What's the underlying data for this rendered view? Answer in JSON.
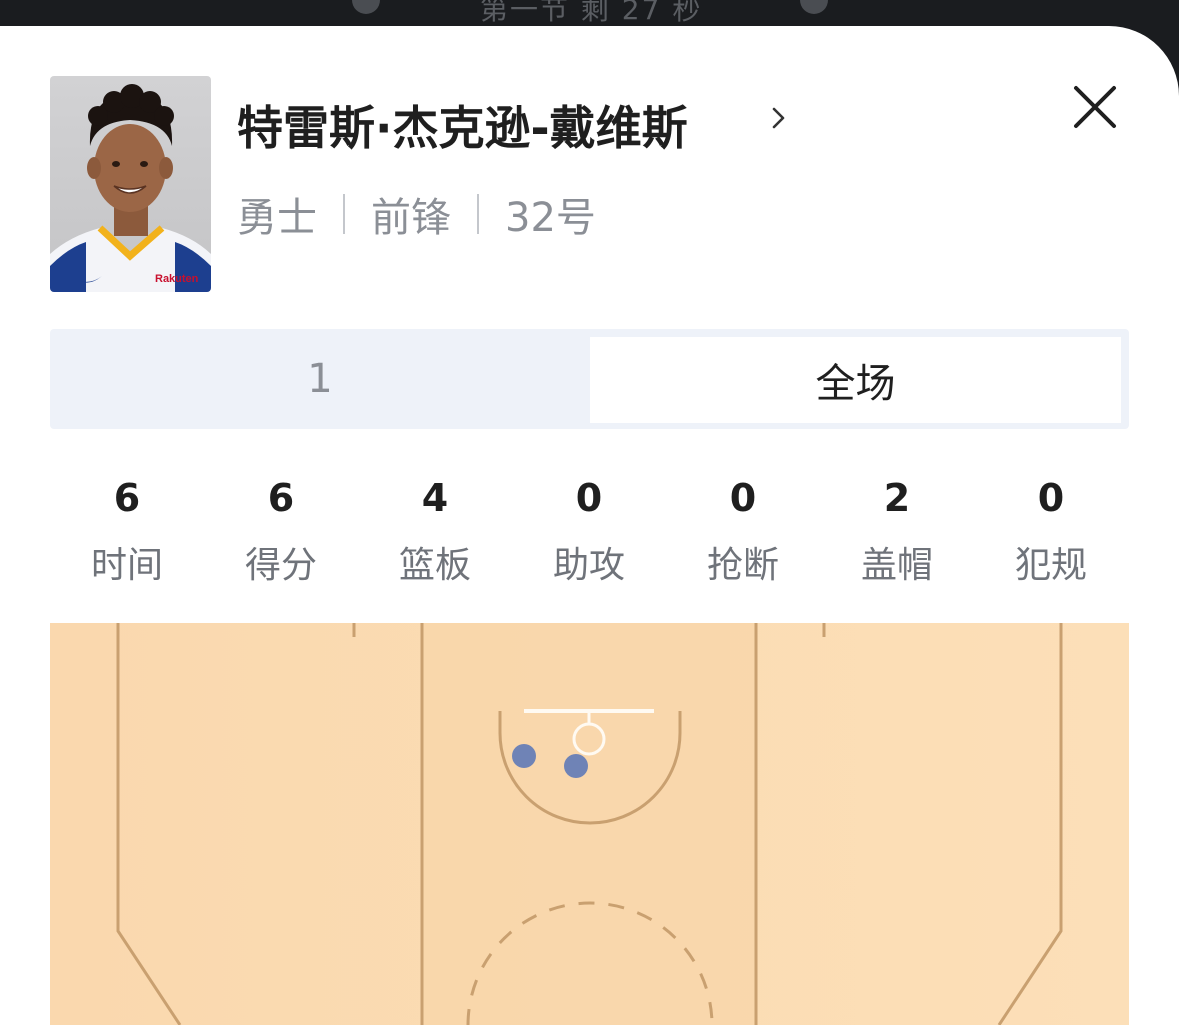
{
  "status_bar": {
    "period_text": "第一节 剩 27 秒"
  },
  "player": {
    "name": "特雷斯·杰克逊-戴维斯",
    "team": "勇士",
    "position": "前锋",
    "number": "32号",
    "jersey_sponsor": "Rakuten"
  },
  "icons": {
    "name_link": "chevron-right-icon",
    "close": "close-icon"
  },
  "tabs": [
    {
      "label": "1",
      "selected": false
    },
    {
      "label": "全场",
      "selected": true
    }
  ],
  "stats": [
    {
      "label": "时间",
      "value": "6"
    },
    {
      "label": "得分",
      "value": "6"
    },
    {
      "label": "篮板",
      "value": "4"
    },
    {
      "label": "助攻",
      "value": "0"
    },
    {
      "label": "抢断",
      "value": "0"
    },
    {
      "label": "盖帽",
      "value": "2"
    },
    {
      "label": "犯规",
      "value": "0"
    }
  ],
  "shot_chart": {
    "made_shot_color": "#6f83b6",
    "court_color": "#fbdcb3",
    "line_color": "#c9a070"
  },
  "colors": {
    "background": "#ffffff",
    "tab_bg": "#eef2f9",
    "text_primary": "#1f1f1f",
    "text_secondary": "#8b8f96"
  }
}
